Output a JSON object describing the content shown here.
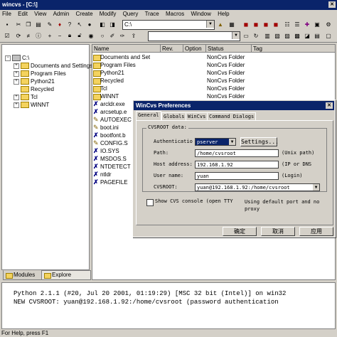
{
  "window": {
    "title": "wincvs - [C:\\]"
  },
  "menu": [
    "File",
    "Edit",
    "View",
    "Admin",
    "Create",
    "Modify",
    "Query",
    "Trace",
    "Macros",
    "Window",
    "Help"
  ],
  "toolbar": {
    "path_combo": "C:\\"
  },
  "tree": {
    "root": "C:\\",
    "items": [
      {
        "label": "Documents and Settings",
        "expandable": true
      },
      {
        "label": "Program Files",
        "expandable": true
      },
      {
        "label": "Python21",
        "expandable": true
      },
      {
        "label": "Recycled",
        "expandable": false
      },
      {
        "label": "Tcl",
        "expandable": true
      },
      {
        "label": "WINNT",
        "expandable": true
      }
    ],
    "tabs": [
      "Modules",
      "Explore"
    ]
  },
  "filelist": {
    "columns": [
      "Name",
      "Rev.",
      "Option",
      "Status",
      "Tag"
    ],
    "rows": [
      {
        "name": "Documents and Setti...",
        "status": "NonCvs Folder",
        "icon": "folder-icon"
      },
      {
        "name": "Program Files",
        "status": "NonCvs Folder",
        "icon": "folder-icon"
      },
      {
        "name": "Python21",
        "status": "NonCvs Folder",
        "icon": "folder-icon"
      },
      {
        "name": "Recycled",
        "status": "NonCvs Folder",
        "icon": "folder-icon"
      },
      {
        "name": "Tcl",
        "status": "NonCvs Folder",
        "icon": "folder-icon"
      },
      {
        "name": "WINNT",
        "status": "NonCvs Folder",
        "icon": "folder-icon"
      },
      {
        "name": "arcldr.exe",
        "status": "",
        "icon": "noncvs-file-icon"
      },
      {
        "name": "arcsetup.e",
        "status": "",
        "icon": "noncvs-file-icon"
      },
      {
        "name": "AUTOEXEC",
        "status": "",
        "icon": "edit-file-icon"
      },
      {
        "name": "boot.ini",
        "status": "",
        "icon": "edit-file-icon"
      },
      {
        "name": "bootfont.b",
        "status": "",
        "icon": "noncvs-file-icon"
      },
      {
        "name": "CONFIG.S",
        "status": "",
        "icon": "edit-file-icon"
      },
      {
        "name": "IO.SYS",
        "status": "",
        "icon": "noncvs-file-icon"
      },
      {
        "name": "MSDOS.S",
        "status": "",
        "icon": "noncvs-file-icon"
      },
      {
        "name": "NTDETECT",
        "status": "",
        "icon": "noncvs-file-icon"
      },
      {
        "name": "ntldr",
        "status": "",
        "icon": "noncvs-file-icon"
      },
      {
        "name": "PAGEFILE",
        "status": "",
        "icon": "noncvs-file-icon"
      }
    ]
  },
  "dialog": {
    "title": "WinCvs Preferences",
    "tabs": [
      "General",
      "Globals",
      "WinCvs",
      "Command Dialogs"
    ],
    "group_label": "CVSROOT data:",
    "auth_label": "Authenticatio",
    "auth_value": "pserver",
    "settings_button": "Settings...",
    "path_label": "Path:",
    "path_value": "/home/cvsroot",
    "path_note": "(Unix path)",
    "host_label": "Host address:",
    "host_value": "192.168.1.92",
    "host_note": "(IP or DNS",
    "user_label": "User name:",
    "user_value": "yuan",
    "user_note": "(Login)",
    "cvsroot_label": "CVSROOT:",
    "cvsroot_value": "yuan@192.168.1.92:/home/cvsroot",
    "console_checkbox": "Show CVS console (open TTY",
    "default_port_note": "Using default port and no proxy",
    "ok_button": "确定",
    "cancel_button": "取消",
    "apply_button": "应用"
  },
  "console": {
    "lines": [
      "Python 2.1.1 (#20, Jul 20 2001, 01:19:29) [MSC 32 bit (Intel)] on win32",
      "NEW CVSROOT: yuan@192.168.1.92:/home/cvsroot (password authentication"
    ]
  },
  "status": {
    "text": "For Help, press F1"
  }
}
